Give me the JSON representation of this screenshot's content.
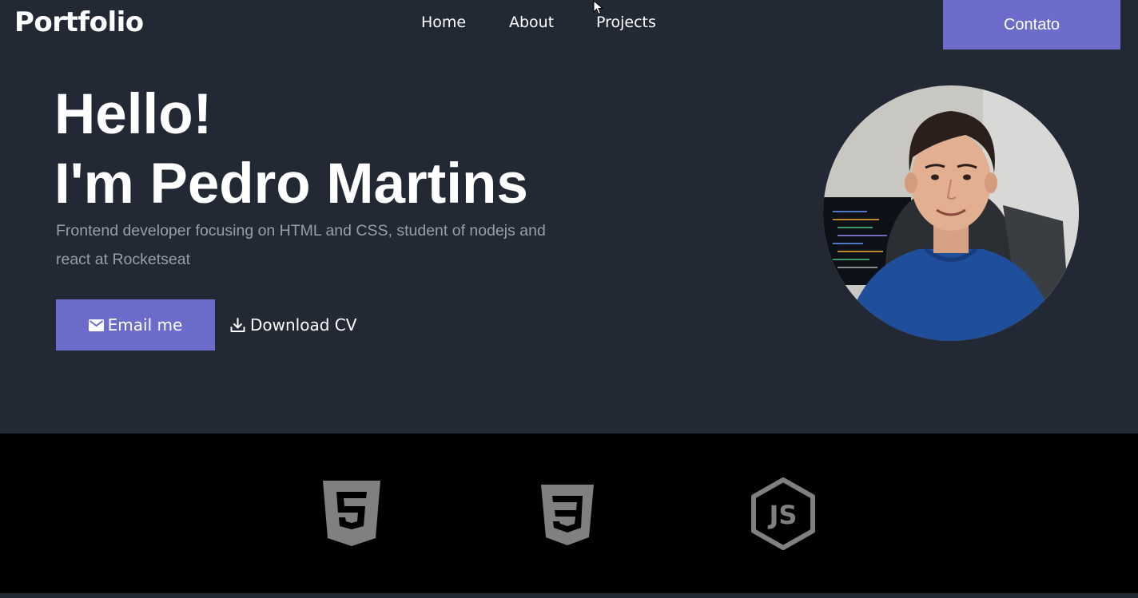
{
  "header": {
    "logo": "Portfolio",
    "nav": [
      {
        "label": "Home"
      },
      {
        "label": "About"
      },
      {
        "label": "Projects"
      }
    ],
    "contact_button": "Contato"
  },
  "hero": {
    "title_line1": "Hello!",
    "title_line2": "I'm Pedro Martins",
    "description": "Frontend developer focusing on HTML and CSS, student of nodejs and react at Rocketseat",
    "email_button": "Email me",
    "download_button": "Download CV"
  },
  "tech_icons": [
    {
      "icon": "html5-icon"
    },
    {
      "icon": "css3-icon"
    },
    {
      "icon": "nodejs-icon"
    }
  ],
  "colors": {
    "background": "#222834",
    "accent": "#6c6ccb",
    "strip": "#000000",
    "muted_text": "#9a9ea8",
    "icon_gray": "#808080"
  }
}
